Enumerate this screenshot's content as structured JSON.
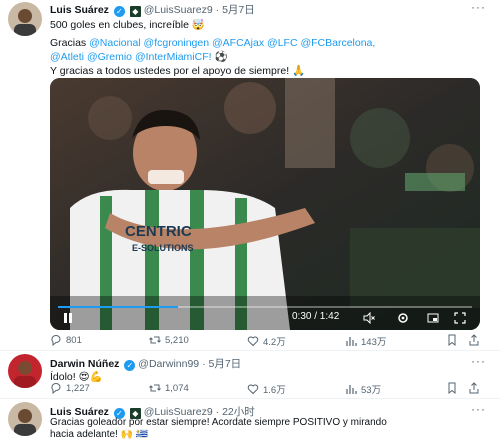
{
  "tweet1": {
    "name": "Luis Suárez",
    "handle": "@LuisSuarez9",
    "sep": "·",
    "date": "5月7日",
    "line1": "500 goles en clubes, increíble 🤯",
    "gracias": "Gracias",
    "mentions_row1": [
      "@Nacional",
      "@fcgroningen",
      "@AFCAjax",
      "@LFC",
      "@FCBarcelona,"
    ],
    "mentions_row2": [
      "@Atleti",
      "@Gremio",
      "@InterMiamiCF!"
    ],
    "ball_emoji": "⚽",
    "line3": "Y gracias a todos ustedes por el apoyo de siempre! 🙏",
    "video": {
      "shirt_text_1": "CENTRIC",
      "shirt_text_2": "E-SOLUTIONS",
      "time": "0:30 / 1:42"
    },
    "stats": {
      "replies": "801",
      "retweets": "5,210",
      "likes": "4.2万",
      "views": "143万"
    }
  },
  "tweet2": {
    "name": "Darwin Núñez",
    "handle": "@Darwinn99",
    "sep": "·",
    "date": "5月7日",
    "text": "Ídolo! 😍💪",
    "stats": {
      "replies": "1,227",
      "retweets": "1,074",
      "likes": "1.6万",
      "views": "53万"
    }
  },
  "tweet3": {
    "name": "Luis Suárez",
    "handle": "@LuisSuarez9",
    "sep": "·",
    "date": "22小时",
    "text_line1": "Gracias goleador por estar siempre! Acordate siempre POSITIVO y mirando",
    "text_line2": "hacia adelante! 🙌 🇺🇾"
  },
  "colors": {
    "link": "#1d9bf0",
    "muted": "#536471",
    "verified": "#1d9bf0"
  }
}
